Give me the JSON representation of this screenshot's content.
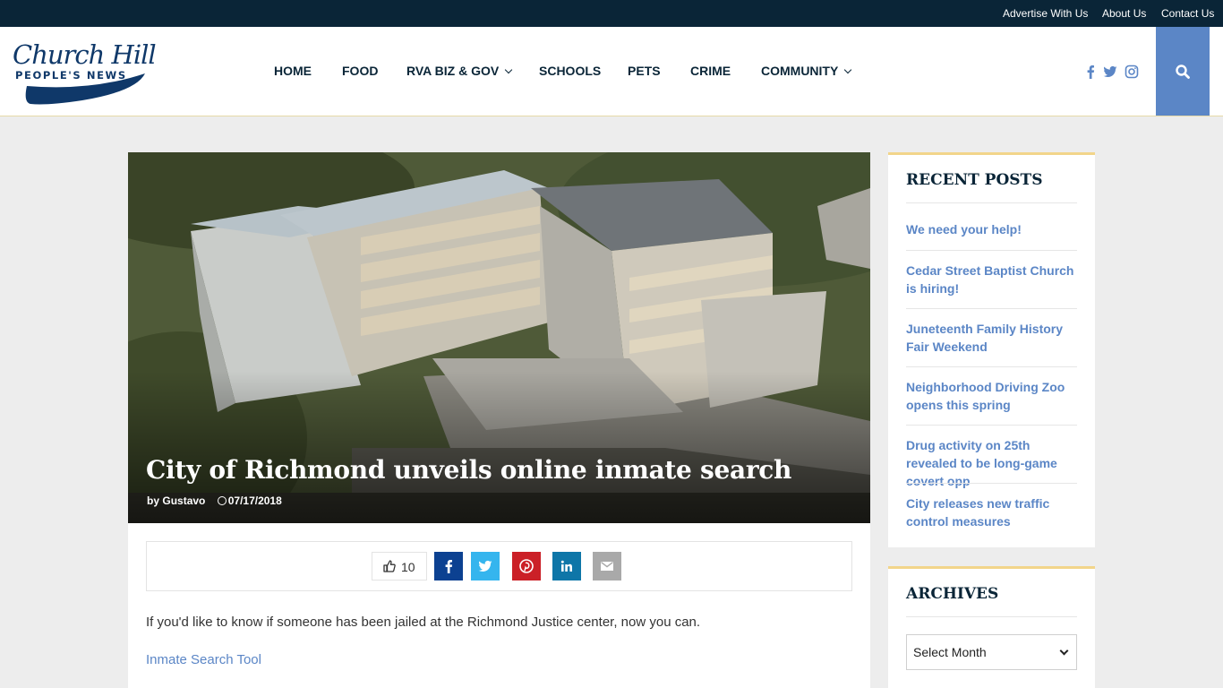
{
  "topbar": {
    "links": [
      "Advertise With Us",
      "About Us",
      "Contact Us"
    ]
  },
  "header": {
    "logo_script": "Church Hill",
    "logo_sub": "PEOPLE'S NEWS",
    "nav": [
      "HOME",
      "FOOD",
      "RVA BIZ & GOV",
      "SCHOOLS",
      "PETS",
      "CRIME",
      "COMMUNITY"
    ],
    "social_icons": [
      "facebook-icon",
      "twitter-icon",
      "instagram-icon"
    ],
    "search_icon": "search-icon",
    "accent_color": "#5b86c6",
    "topbar_color": "#0a2537"
  },
  "article": {
    "title": "City of Richmond unveils online inmate search",
    "author_prefix": "by",
    "author": "Gustavo",
    "date": "07/17/2018",
    "likes": "10",
    "share_buttons": [
      "facebook-icon",
      "twitter-icon",
      "pinterest-icon",
      "linkedin-icon",
      "email-icon"
    ],
    "paragraph": "If you'd like to know if someone has been jailed at the Richmond Justice center, now you can.",
    "link_text": "Inmate Search Tool"
  },
  "sidebar": {
    "recent_title": "RECENT POSTS",
    "recent_posts": [
      "We need your help!",
      "Cedar Street Baptist Church is hiring!",
      "Juneteenth Family History Fair Weekend",
      "Neighborhood Driving Zoo opens this spring",
      "Drug activity on 25th revealed to be long-game covert opp",
      "City releases new traffic control measures"
    ],
    "archives_title": "ARCHIVES",
    "archives_select": "Select Month"
  }
}
